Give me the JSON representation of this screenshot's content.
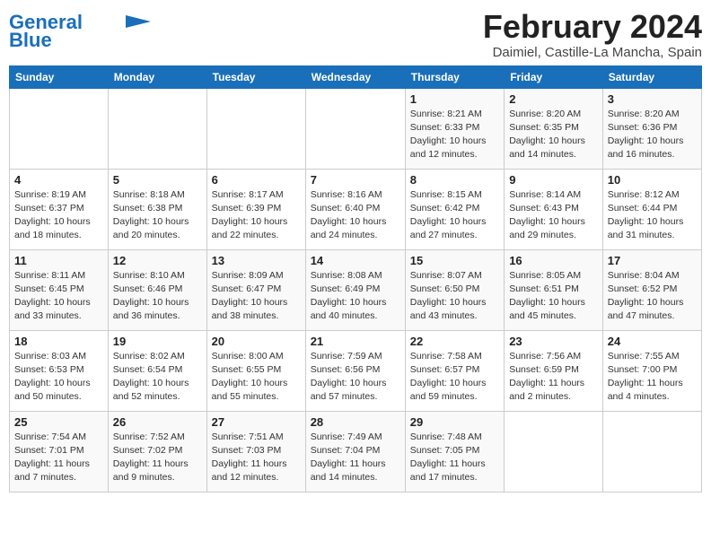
{
  "header": {
    "logo_line1": "General",
    "logo_line2": "Blue",
    "month_year": "February 2024",
    "location": "Daimiel, Castille-La Mancha, Spain"
  },
  "weekdays": [
    "Sunday",
    "Monday",
    "Tuesday",
    "Wednesday",
    "Thursday",
    "Friday",
    "Saturday"
  ],
  "weeks": [
    [
      {
        "num": "",
        "info": ""
      },
      {
        "num": "",
        "info": ""
      },
      {
        "num": "",
        "info": ""
      },
      {
        "num": "",
        "info": ""
      },
      {
        "num": "1",
        "info": "Sunrise: 8:21 AM\nSunset: 6:33 PM\nDaylight: 10 hours\nand 12 minutes."
      },
      {
        "num": "2",
        "info": "Sunrise: 8:20 AM\nSunset: 6:35 PM\nDaylight: 10 hours\nand 14 minutes."
      },
      {
        "num": "3",
        "info": "Sunrise: 8:20 AM\nSunset: 6:36 PM\nDaylight: 10 hours\nand 16 minutes."
      }
    ],
    [
      {
        "num": "4",
        "info": "Sunrise: 8:19 AM\nSunset: 6:37 PM\nDaylight: 10 hours\nand 18 minutes."
      },
      {
        "num": "5",
        "info": "Sunrise: 8:18 AM\nSunset: 6:38 PM\nDaylight: 10 hours\nand 20 minutes."
      },
      {
        "num": "6",
        "info": "Sunrise: 8:17 AM\nSunset: 6:39 PM\nDaylight: 10 hours\nand 22 minutes."
      },
      {
        "num": "7",
        "info": "Sunrise: 8:16 AM\nSunset: 6:40 PM\nDaylight: 10 hours\nand 24 minutes."
      },
      {
        "num": "8",
        "info": "Sunrise: 8:15 AM\nSunset: 6:42 PM\nDaylight: 10 hours\nand 27 minutes."
      },
      {
        "num": "9",
        "info": "Sunrise: 8:14 AM\nSunset: 6:43 PM\nDaylight: 10 hours\nand 29 minutes."
      },
      {
        "num": "10",
        "info": "Sunrise: 8:12 AM\nSunset: 6:44 PM\nDaylight: 10 hours\nand 31 minutes."
      }
    ],
    [
      {
        "num": "11",
        "info": "Sunrise: 8:11 AM\nSunset: 6:45 PM\nDaylight: 10 hours\nand 33 minutes."
      },
      {
        "num": "12",
        "info": "Sunrise: 8:10 AM\nSunset: 6:46 PM\nDaylight: 10 hours\nand 36 minutes."
      },
      {
        "num": "13",
        "info": "Sunrise: 8:09 AM\nSunset: 6:47 PM\nDaylight: 10 hours\nand 38 minutes."
      },
      {
        "num": "14",
        "info": "Sunrise: 8:08 AM\nSunset: 6:49 PM\nDaylight: 10 hours\nand 40 minutes."
      },
      {
        "num": "15",
        "info": "Sunrise: 8:07 AM\nSunset: 6:50 PM\nDaylight: 10 hours\nand 43 minutes."
      },
      {
        "num": "16",
        "info": "Sunrise: 8:05 AM\nSunset: 6:51 PM\nDaylight: 10 hours\nand 45 minutes."
      },
      {
        "num": "17",
        "info": "Sunrise: 8:04 AM\nSunset: 6:52 PM\nDaylight: 10 hours\nand 47 minutes."
      }
    ],
    [
      {
        "num": "18",
        "info": "Sunrise: 8:03 AM\nSunset: 6:53 PM\nDaylight: 10 hours\nand 50 minutes."
      },
      {
        "num": "19",
        "info": "Sunrise: 8:02 AM\nSunset: 6:54 PM\nDaylight: 10 hours\nand 52 minutes."
      },
      {
        "num": "20",
        "info": "Sunrise: 8:00 AM\nSunset: 6:55 PM\nDaylight: 10 hours\nand 55 minutes."
      },
      {
        "num": "21",
        "info": "Sunrise: 7:59 AM\nSunset: 6:56 PM\nDaylight: 10 hours\nand 57 minutes."
      },
      {
        "num": "22",
        "info": "Sunrise: 7:58 AM\nSunset: 6:57 PM\nDaylight: 10 hours\nand 59 minutes."
      },
      {
        "num": "23",
        "info": "Sunrise: 7:56 AM\nSunset: 6:59 PM\nDaylight: 11 hours\nand 2 minutes."
      },
      {
        "num": "24",
        "info": "Sunrise: 7:55 AM\nSunset: 7:00 PM\nDaylight: 11 hours\nand 4 minutes."
      }
    ],
    [
      {
        "num": "25",
        "info": "Sunrise: 7:54 AM\nSunset: 7:01 PM\nDaylight: 11 hours\nand 7 minutes."
      },
      {
        "num": "26",
        "info": "Sunrise: 7:52 AM\nSunset: 7:02 PM\nDaylight: 11 hours\nand 9 minutes."
      },
      {
        "num": "27",
        "info": "Sunrise: 7:51 AM\nSunset: 7:03 PM\nDaylight: 11 hours\nand 12 minutes."
      },
      {
        "num": "28",
        "info": "Sunrise: 7:49 AM\nSunset: 7:04 PM\nDaylight: 11 hours\nand 14 minutes."
      },
      {
        "num": "29",
        "info": "Sunrise: 7:48 AM\nSunset: 7:05 PM\nDaylight: 11 hours\nand 17 minutes."
      },
      {
        "num": "",
        "info": ""
      },
      {
        "num": "",
        "info": ""
      }
    ]
  ]
}
